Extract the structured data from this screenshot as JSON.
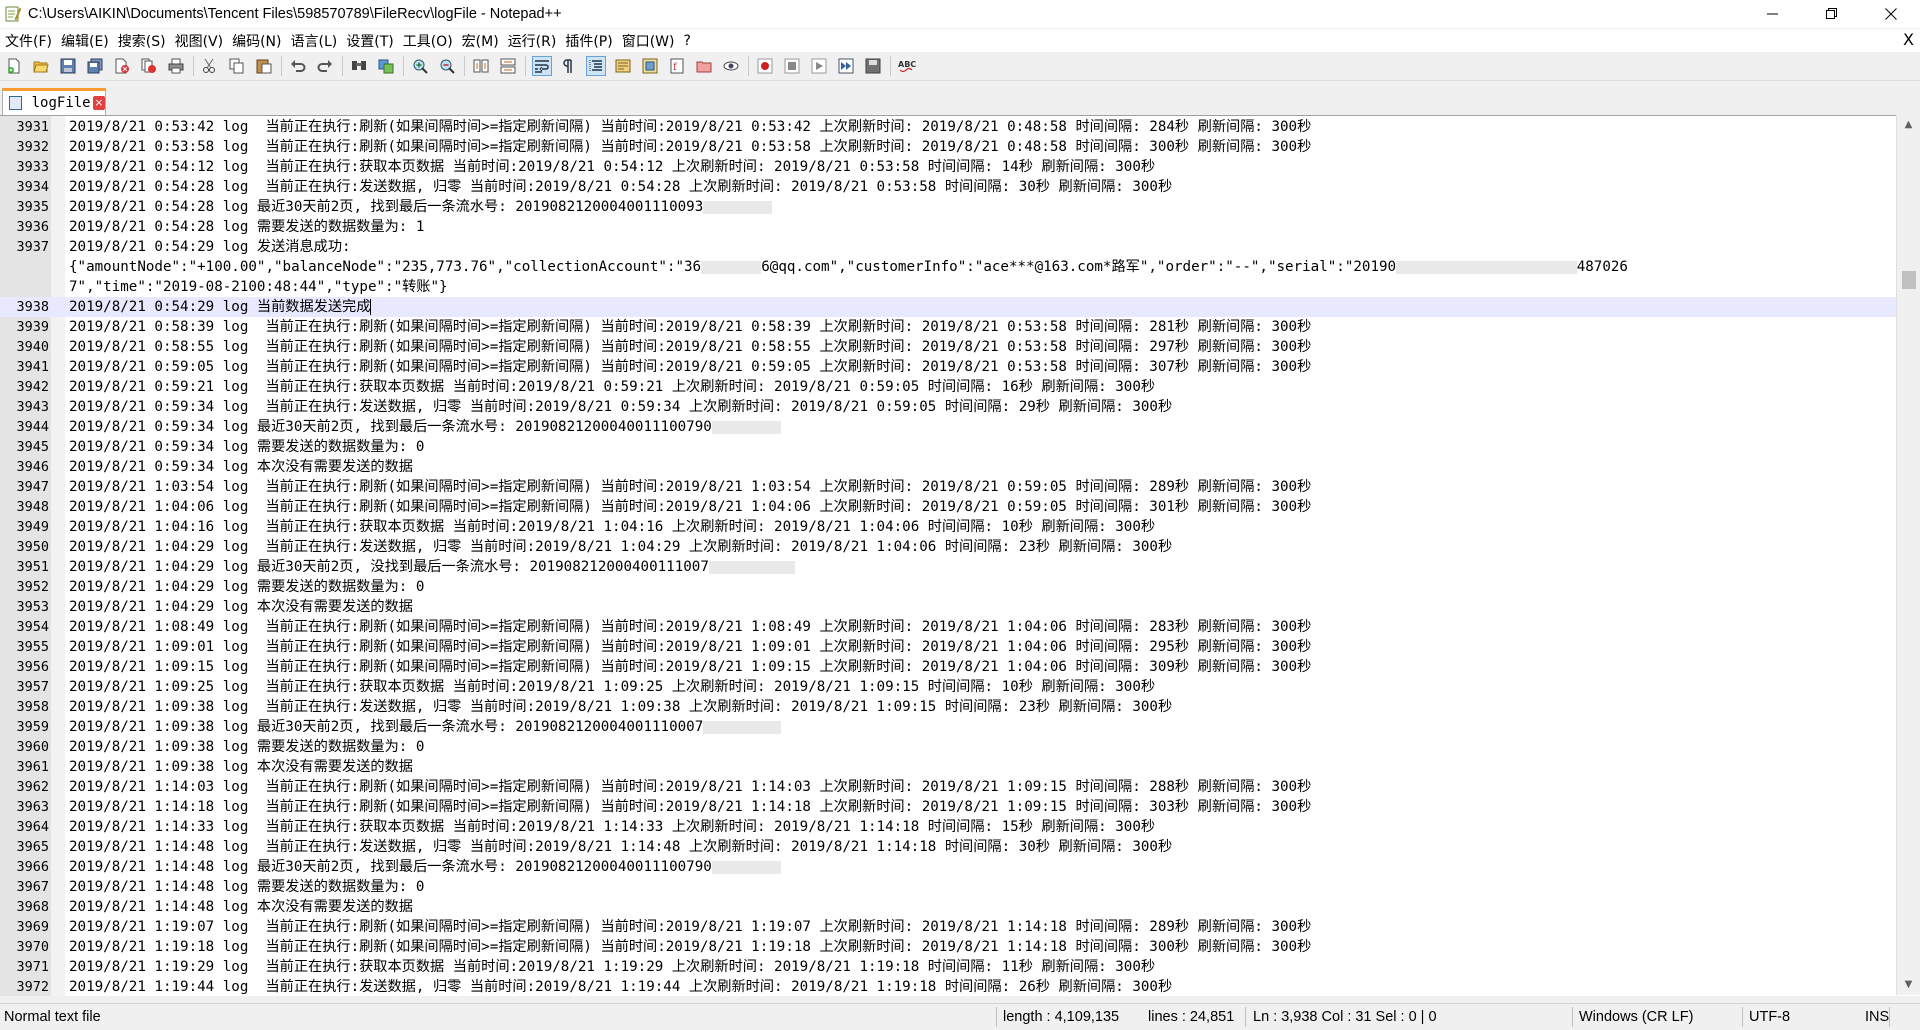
{
  "window": {
    "title": "C:\\Users\\AIKIN\\Documents\\Tencent Files\\598570789\\FileRecv\\logFile - Notepad++",
    "minimize_glyph": "—",
    "maximize_glyph": "❐",
    "close_glyph": "✕"
  },
  "menu": {
    "items": [
      "文件(F)",
      "编辑(E)",
      "搜索(S)",
      "视图(V)",
      "编码(N)",
      "语言(L)",
      "设置(T)",
      "工具(O)",
      "宏(M)",
      "运行(R)",
      "插件(P)",
      "窗口(W)",
      "?"
    ],
    "close_glyph": "X"
  },
  "tab": {
    "label": "logFile",
    "close_glyph": "×"
  },
  "editor": {
    "current_line": 3938,
    "lines": [
      {
        "n": "3931",
        "t": "2019/8/21 0:53:42 log  当前正在执行:刷新(如果间隔时间>=指定刷新间隔) 当前时间:2019/8/21 0:53:42 上次刷新时间: 2019/8/21 0:48:58 时间间隔: 284秒 刷新间隔: 300秒"
      },
      {
        "n": "3932",
        "t": "2019/8/21 0:53:58 log  当前正在执行:刷新(如果间隔时间>=指定刷新间隔) 当前时间:2019/8/21 0:53:58 上次刷新时间: 2019/8/21 0:48:58 时间间隔: 300秒 刷新间隔: 300秒"
      },
      {
        "n": "3933",
        "t": "2019/8/21 0:54:12 log  当前正在执行:获取本页数据 当前时间:2019/8/21 0:54:12 上次刷新时间: 2019/8/21 0:53:58 时间间隔: 14秒 刷新间隔: 300秒"
      },
      {
        "n": "3934",
        "t": "2019/8/21 0:54:28 log  当前正在执行:发送数据, 归零 当前时间:2019/8/21 0:54:28 上次刷新时间: 2019/8/21 0:53:58 时间间隔: 30秒 刷新间隔: 300秒"
      },
      {
        "n": "3935",
        "t": "2019/8/21 0:54:28 log 最近30天前2页, 找到最后一条流水号: 2019082120004001110093",
        "mask": 8
      },
      {
        "n": "3936",
        "t": "2019/8/21 0:54:28 log 需要发送的数据数量为: 1"
      },
      {
        "n": "3937",
        "t": "2019/8/21 0:54:29 log 发送消息成功:"
      },
      {
        "n": "",
        "t": "{\"amountNode\":\"+100.00\",\"balanceNode\":\"235,773.76\",\"collectionAccount\":\"36",
        "mask": 7,
        "t2": "6@qq.com\",\"customerInfo\":\"ace***@163.com*路军\",\"order\":\"--\",\"serial\":\"20190",
        "mask2": 21,
        "t3": "487026"
      },
      {
        "n": "",
        "t": "7\",\"time\":\"2019-08-2100:48:44\",\"type\":\"转账\"}"
      },
      {
        "n": "3938",
        "t": "2019/8/21 0:54:29 log 当前数据发送完成",
        "caret": true
      },
      {
        "n": "3939",
        "t": "2019/8/21 0:58:39 log  当前正在执行:刷新(如果间隔时间>=指定刷新间隔) 当前时间:2019/8/21 0:58:39 上次刷新时间: 2019/8/21 0:53:58 时间间隔: 281秒 刷新间隔: 300秒"
      },
      {
        "n": "3940",
        "t": "2019/8/21 0:58:55 log  当前正在执行:刷新(如果间隔时间>=指定刷新间隔) 当前时间:2019/8/21 0:58:55 上次刷新时间: 2019/8/21 0:53:58 时间间隔: 297秒 刷新间隔: 300秒"
      },
      {
        "n": "3941",
        "t": "2019/8/21 0:59:05 log  当前正在执行:刷新(如果间隔时间>=指定刷新间隔) 当前时间:2019/8/21 0:59:05 上次刷新时间: 2019/8/21 0:53:58 时间间隔: 307秒 刷新间隔: 300秒"
      },
      {
        "n": "3942",
        "t": "2019/8/21 0:59:21 log  当前正在执行:获取本页数据 当前时间:2019/8/21 0:59:21 上次刷新时间: 2019/8/21 0:59:05 时间间隔: 16秒 刷新间隔: 300秒"
      },
      {
        "n": "3943",
        "t": "2019/8/21 0:59:34 log  当前正在执行:发送数据, 归零 当前时间:2019/8/21 0:59:34 上次刷新时间: 2019/8/21 0:59:05 时间间隔: 29秒 刷新间隔: 300秒"
      },
      {
        "n": "3944",
        "t": "2019/8/21 0:59:34 log 最近30天前2页, 找到最后一条流水号: 20190821200040011100790",
        "mask": 8
      },
      {
        "n": "3945",
        "t": "2019/8/21 0:59:34 log 需要发送的数据数量为: 0"
      },
      {
        "n": "3946",
        "t": "2019/8/21 0:59:34 log 本次没有需要发送的数据"
      },
      {
        "n": "3947",
        "t": "2019/8/21 1:03:54 log  当前正在执行:刷新(如果间隔时间>=指定刷新间隔) 当前时间:2019/8/21 1:03:54 上次刷新时间: 2019/8/21 0:59:05 时间间隔: 289秒 刷新间隔: 300秒"
      },
      {
        "n": "3948",
        "t": "2019/8/21 1:04:06 log  当前正在执行:刷新(如果间隔时间>=指定刷新间隔) 当前时间:2019/8/21 1:04:06 上次刷新时间: 2019/8/21 0:59:05 时间间隔: 301秒 刷新间隔: 300秒"
      },
      {
        "n": "3949",
        "t": "2019/8/21 1:04:16 log  当前正在执行:获取本页数据 当前时间:2019/8/21 1:04:16 上次刷新时间: 2019/8/21 1:04:06 时间间隔: 10秒 刷新间隔: 300秒"
      },
      {
        "n": "3950",
        "t": "2019/8/21 1:04:29 log  当前正在执行:发送数据, 归零 当前时间:2019/8/21 1:04:29 上次刷新时间: 2019/8/21 1:04:06 时间间隔: 23秒 刷新间隔: 300秒"
      },
      {
        "n": "3951",
        "t": "2019/8/21 1:04:29 log 最近30天前2页, 没找到最后一条流水号: 201908212000400111007",
        "mask": 10
      },
      {
        "n": "3952",
        "t": "2019/8/21 1:04:29 log 需要发送的数据数量为: 0"
      },
      {
        "n": "3953",
        "t": "2019/8/21 1:04:29 log 本次没有需要发送的数据"
      },
      {
        "n": "3954",
        "t": "2019/8/21 1:08:49 log  当前正在执行:刷新(如果间隔时间>=指定刷新间隔) 当前时间:2019/8/21 1:08:49 上次刷新时间: 2019/8/21 1:04:06 时间间隔: 283秒 刷新间隔: 300秒"
      },
      {
        "n": "3955",
        "t": "2019/8/21 1:09:01 log  当前正在执行:刷新(如果间隔时间>=指定刷新间隔) 当前时间:2019/8/21 1:09:01 上次刷新时间: 2019/8/21 1:04:06 时间间隔: 295秒 刷新间隔: 300秒"
      },
      {
        "n": "3956",
        "t": "2019/8/21 1:09:15 log  当前正在执行:刷新(如果间隔时间>=指定刷新间隔) 当前时间:2019/8/21 1:09:15 上次刷新时间: 2019/8/21 1:04:06 时间间隔: 309秒 刷新间隔: 300秒"
      },
      {
        "n": "3957",
        "t": "2019/8/21 1:09:25 log  当前正在执行:获取本页数据 当前时间:2019/8/21 1:09:25 上次刷新时间: 2019/8/21 1:09:15 时间间隔: 10秒 刷新间隔: 300秒"
      },
      {
        "n": "3958",
        "t": "2019/8/21 1:09:38 log  当前正在执行:发送数据, 归零 当前时间:2019/8/21 1:09:38 上次刷新时间: 2019/8/21 1:09:15 时间间隔: 23秒 刷新间隔: 300秒"
      },
      {
        "n": "3959",
        "t": "2019/8/21 1:09:38 log 最近30天前2页, 找到最后一条流水号: 2019082120004001110007",
        "mask": 9
      },
      {
        "n": "3960",
        "t": "2019/8/21 1:09:38 log 需要发送的数据数量为: 0"
      },
      {
        "n": "3961",
        "t": "2019/8/21 1:09:38 log 本次没有需要发送的数据"
      },
      {
        "n": "3962",
        "t": "2019/8/21 1:14:03 log  当前正在执行:刷新(如果间隔时间>=指定刷新间隔) 当前时间:2019/8/21 1:14:03 上次刷新时间: 2019/8/21 1:09:15 时间间隔: 288秒 刷新间隔: 300秒"
      },
      {
        "n": "3963",
        "t": "2019/8/21 1:14:18 log  当前正在执行:刷新(如果间隔时间>=指定刷新间隔) 当前时间:2019/8/21 1:14:18 上次刷新时间: 2019/8/21 1:09:15 时间间隔: 303秒 刷新间隔: 300秒"
      },
      {
        "n": "3964",
        "t": "2019/8/21 1:14:33 log  当前正在执行:获取本页数据 当前时间:2019/8/21 1:14:33 上次刷新时间: 2019/8/21 1:14:18 时间间隔: 15秒 刷新间隔: 300秒"
      },
      {
        "n": "3965",
        "t": "2019/8/21 1:14:48 log  当前正在执行:发送数据, 归零 当前时间:2019/8/21 1:14:48 上次刷新时间: 2019/8/21 1:14:18 时间间隔: 30秒 刷新间隔: 300秒"
      },
      {
        "n": "3966",
        "t": "2019/8/21 1:14:48 log 最近30天前2页, 找到最后一条流水号: 20190821200040011100790",
        "mask": 8
      },
      {
        "n": "3967",
        "t": "2019/8/21 1:14:48 log 需要发送的数据数量为: 0"
      },
      {
        "n": "3968",
        "t": "2019/8/21 1:14:48 log 本次没有需要发送的数据"
      },
      {
        "n": "3969",
        "t": "2019/8/21 1:19:07 log  当前正在执行:刷新(如果间隔时间>=指定刷新间隔) 当前时间:2019/8/21 1:19:07 上次刷新时间: 2019/8/21 1:14:18 时间间隔: 289秒 刷新间隔: 300秒"
      },
      {
        "n": "3970",
        "t": "2019/8/21 1:19:18 log  当前正在执行:刷新(如果间隔时间>=指定刷新间隔) 当前时间:2019/8/21 1:19:18 上次刷新时间: 2019/8/21 1:14:18 时间间隔: 300秒 刷新间隔: 300秒"
      },
      {
        "n": "3971",
        "t": "2019/8/21 1:19:29 log  当前正在执行:获取本页数据 当前时间:2019/8/21 1:19:29 上次刷新时间: 2019/8/21 1:19:18 时间间隔: 11秒 刷新间隔: 300秒"
      },
      {
        "n": "3972",
        "t": "2019/8/21 1:19:44 log  当前正在执行:发送数据, 归零 当前时间:2019/8/21 1:19:44 上次刷新时间: 2019/8/21 1:19:18 时间间隔: 26秒 刷新间隔: 300秒"
      }
    ]
  },
  "status": {
    "file_type": "Normal text file",
    "length": "length : 4,109,135",
    "lines": "lines : 24,851",
    "position": "Ln : 3,938    Col : 31    Sel : 0 | 0",
    "eol": "Windows (CR LF)",
    "encoding": "UTF-8",
    "mode": "INS"
  }
}
